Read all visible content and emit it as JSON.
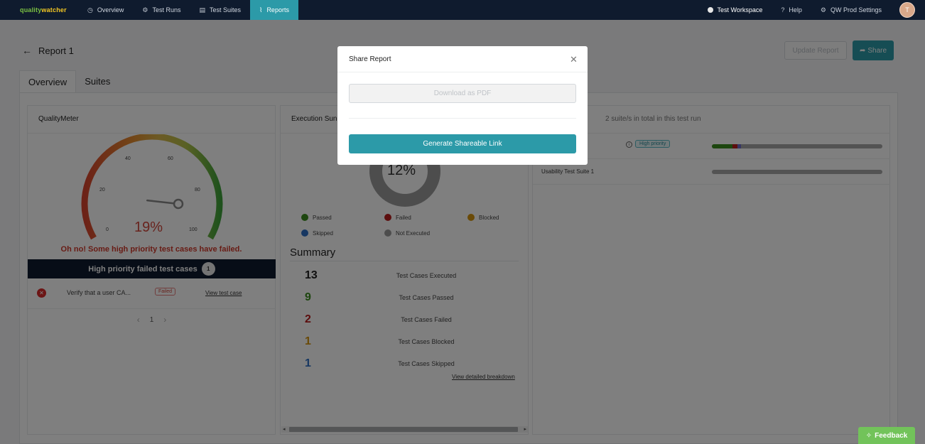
{
  "nav": {
    "logo_text_1": "quality",
    "logo_text_2": "watcher",
    "items": [
      {
        "label": "Overview",
        "icon": "dashboard-icon"
      },
      {
        "label": "Test Runs",
        "icon": "gear-icon"
      },
      {
        "label": "Test Suites",
        "icon": "document-icon"
      },
      {
        "label": "Reports",
        "icon": "chart-icon"
      }
    ],
    "workspace": "Test Workspace",
    "help": "Help",
    "settings": "QW Prod Settings",
    "avatar_initial": "T"
  },
  "page": {
    "title": "Report 1",
    "update_button": "Update Report",
    "share_button": "Share",
    "tabs": [
      "Overview",
      "Suites"
    ]
  },
  "quality_meter": {
    "title": "QualityMeter",
    "ticks": [
      "0",
      "20",
      "40",
      "60",
      "80",
      "100"
    ],
    "value_text": "19%",
    "value": 19,
    "message": "Oh no! Some high priority test cases have failed.",
    "high_priority_label": "High priority failed test cases",
    "high_priority_count": "1",
    "failed_case": {
      "name": "Verify that a user CA...",
      "status": "Failed",
      "link": "View test case"
    },
    "page": "1"
  },
  "execution": {
    "title": "Execution Summary",
    "title_visible": "Execution Sun",
    "donut_text": "12%",
    "legend": [
      {
        "label": "Passed",
        "color": "#3a8d1e"
      },
      {
        "label": "Failed",
        "color": "#b91c1c"
      },
      {
        "label": "Blocked",
        "color": "#d4940f"
      },
      {
        "label": "Skipped",
        "color": "#2f6fc4"
      },
      {
        "label": "Not Executed",
        "color": "#9a9a9a"
      }
    ],
    "summary_title": "Summary",
    "rows": [
      {
        "num": "13",
        "label": "Test Cases Executed",
        "color": "#222222"
      },
      {
        "num": "9",
        "label": "Test Cases Passed",
        "color": "#3a8d1e"
      },
      {
        "num": "2",
        "label": "Test Cases Failed",
        "color": "#b91c1c"
      },
      {
        "num": "1",
        "label": "Test Cases Blocked",
        "color": "#d4940f"
      },
      {
        "num": "1",
        "label": "Test Cases Skipped",
        "color": "#2f6fc4"
      }
    ],
    "breakdown_link": "View detailed breakdown"
  },
  "suites": {
    "title_visible": "ary",
    "subtitle": "2 suite/s in total in this test run",
    "rows": [
      {
        "name": "",
        "priority_badge": "High priority",
        "passed": 0.12,
        "failed": 0.03,
        "other": 0.02
      },
      {
        "name": "Usability Test Suite 1",
        "priority_badge": "",
        "passed": 0,
        "failed": 0,
        "other": 0
      }
    ]
  },
  "modal": {
    "title": "Share Report",
    "download_button": "Download as PDF",
    "generate_button": "Generate Shareable Link"
  },
  "feedback": "Feedback"
}
